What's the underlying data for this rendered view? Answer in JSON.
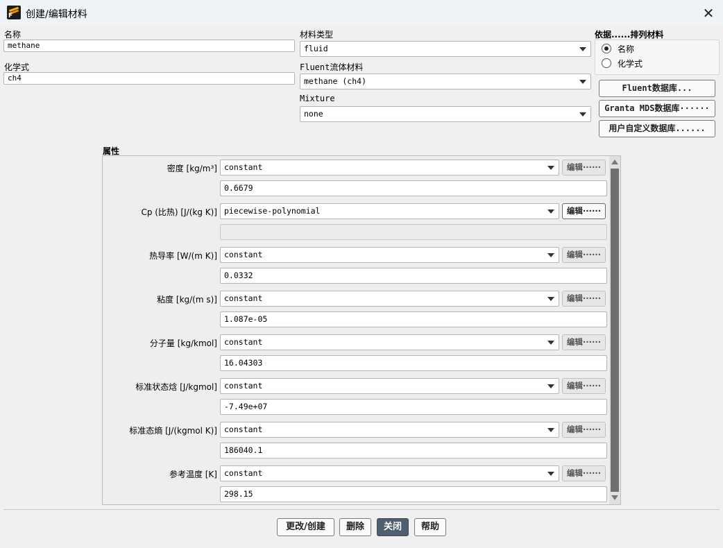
{
  "window": {
    "title": "创建/编辑材料",
    "close_icon": "close-icon"
  },
  "name": {
    "label": "名称",
    "value": "methane"
  },
  "formula": {
    "label": "化学式",
    "value": "ch4"
  },
  "material_type": {
    "label": "材料类型",
    "value": "fluid"
  },
  "fluent_material": {
    "label": "Fluent流体材料",
    "value": "methane (ch4)"
  },
  "mixture": {
    "label": "Mixture",
    "value": "none"
  },
  "order_by": {
    "label": "依据......排列材料",
    "options": [
      {
        "label": "名称",
        "selected": true
      },
      {
        "label": "化学式",
        "selected": false
      }
    ]
  },
  "databases": {
    "fluent": "Fluent数据库...",
    "granta": "Granta MDS数据库······",
    "user": "用户自定义数据库......"
  },
  "properties": {
    "label": "属性",
    "edit_label": "编辑······",
    "items": [
      {
        "label": "密度 [kg/m³]",
        "method": "constant",
        "value": "0.6679"
      },
      {
        "label": "Cp (比热) [J/(kg K)]",
        "method": "piecewise-polynomial",
        "value": ""
      },
      {
        "label": "热导率 [W/(m K)]",
        "method": "constant",
        "value": "0.0332"
      },
      {
        "label": "粘度 [kg/(m s)]",
        "method": "constant",
        "value": "1.087e-05"
      },
      {
        "label": "分子量 [kg/kmol]",
        "method": "constant",
        "value": "16.04303"
      },
      {
        "label": "标准状态焓 [J/kgmol]",
        "method": "constant",
        "value": "-7.49e+07"
      },
      {
        "label": "标准态熵 [J/(kgmol K)]",
        "method": "constant",
        "value": "186040.1"
      },
      {
        "label": "参考温度 [K]",
        "method": "constant",
        "value": "298.15"
      }
    ]
  },
  "footer": {
    "change_create": "更改/创建",
    "delete": "删除",
    "close": "关闭",
    "help": "帮助"
  }
}
